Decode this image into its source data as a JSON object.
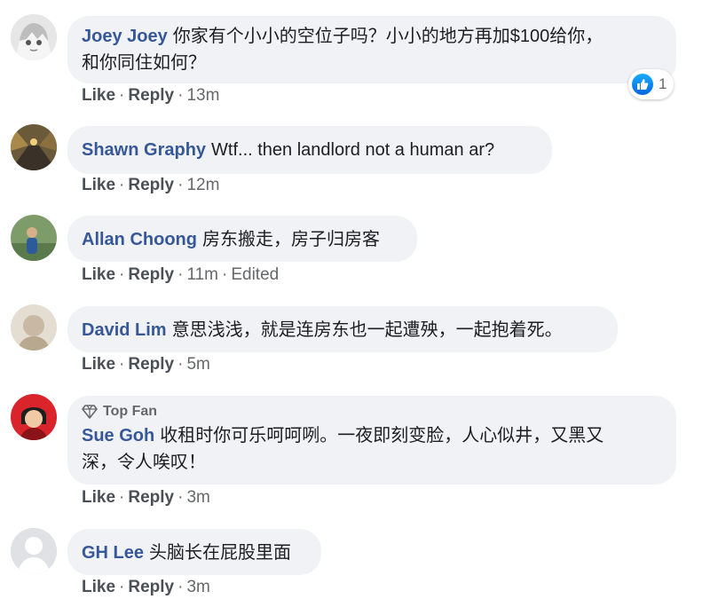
{
  "actions": {
    "like": "Like",
    "reply": "Reply",
    "dot": "·"
  },
  "comments": [
    {
      "author": "Joey Joey",
      "text_line1": "你家有个小小的空位子吗？小小的地方再加$100给你，",
      "text_line2": "和你同住如何？",
      "time": "13m",
      "reaction_count": "1"
    },
    {
      "author": "Shawn Graphy",
      "text": "Wtf... then landlord not a human ar?",
      "time": "12m"
    },
    {
      "author": "Allan Choong",
      "text": "房东搬走，房子归房客",
      "time": "11m",
      "edited": "Edited"
    },
    {
      "author": "David Lim",
      "text": "意思浅浅，就是连房东也一起遭殃，一起抱着死。",
      "time": "5m"
    },
    {
      "badge": "Top Fan",
      "author": "Sue Goh",
      "text_line1": "收租时你可乐呵呵咧。一夜即刻变脸，人心似井，又黑又",
      "text_line2": "深，令人唉叹！",
      "time": "3m"
    },
    {
      "author": "GH Lee",
      "text": "头脑长在屁股里面",
      "time": "3m"
    }
  ],
  "colors": {
    "author": "#365899",
    "bubble": "#f0f2f5",
    "meta": "#65676b",
    "like_blue": "#1877f2"
  },
  "icons": {
    "reaction": "like-thumb-icon",
    "badge": "diamond-icon",
    "default_avatar": "silhouette-icon"
  }
}
